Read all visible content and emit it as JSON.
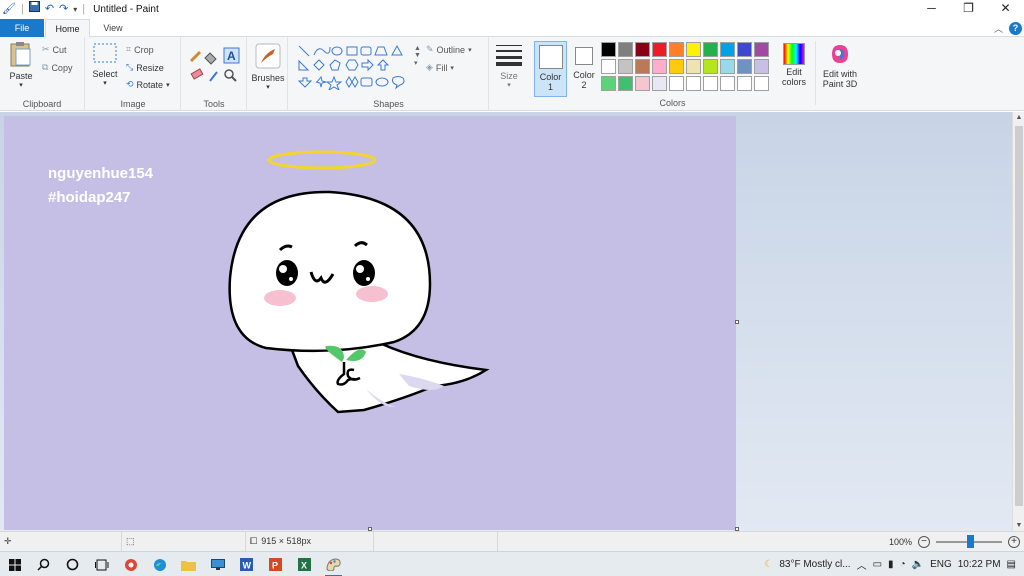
{
  "window": {
    "title": "Untitled - Paint"
  },
  "window_controls": {
    "minimize": "─",
    "restore": "❐",
    "close": "✕"
  },
  "tabs": {
    "file": "File",
    "home": "Home",
    "view": "View"
  },
  "ribbon": {
    "clipboard": {
      "label": "Clipboard",
      "paste": "Paste",
      "cut": "Cut",
      "copy": "Copy"
    },
    "image": {
      "label": "Image",
      "select": "Select",
      "crop": "Crop",
      "resize": "Resize",
      "rotate": "Rotate"
    },
    "tools": {
      "label": "Tools"
    },
    "brushes": {
      "label": "Brushes"
    },
    "shapes": {
      "label": "Shapes",
      "outline": "Outline",
      "fill": "Fill"
    },
    "size": {
      "label": "Size"
    },
    "color1": {
      "label_line1": "Color",
      "label_line2": "1"
    },
    "color2": {
      "label_line1": "Color",
      "label_line2": "2"
    },
    "colors": {
      "label": "Colors"
    },
    "edit_colors": {
      "line1": "Edit",
      "line2": "colors"
    },
    "edit_paint3d": {
      "line1": "Edit with",
      "line2": "Paint 3D"
    },
    "palette": [
      "#000000",
      "#7f7f7f",
      "#880015",
      "#ed1c24",
      "#ff7f27",
      "#fff200",
      "#22b14c",
      "#00a2e8",
      "#3f48cc",
      "#a349a4",
      "#ffffff",
      "#c3c3c3",
      "#b97a57",
      "#ffaec9",
      "#ffc90e",
      "#efe4b0",
      "#b5e61d",
      "#99d9ea",
      "#7092be",
      "#c8bfe7",
      "#5cd37a",
      "#3fbf6f",
      "#f5c6d0",
      "#e8e8f5",
      "#ffffff",
      "#ffffff",
      "#ffffff",
      "#ffffff",
      "#ffffff",
      "#ffffff"
    ]
  },
  "canvas": {
    "background": "#c6bfe5",
    "text_line1": "nguyenhue154",
    "text_line2": "#hoidap247"
  },
  "statusbar": {
    "dimensions": "915 × 518px",
    "zoom": "100%"
  },
  "taskbar": {
    "weather": "83°F  Mostly cl...",
    "language": "ENG",
    "time": "10:22 PM"
  }
}
